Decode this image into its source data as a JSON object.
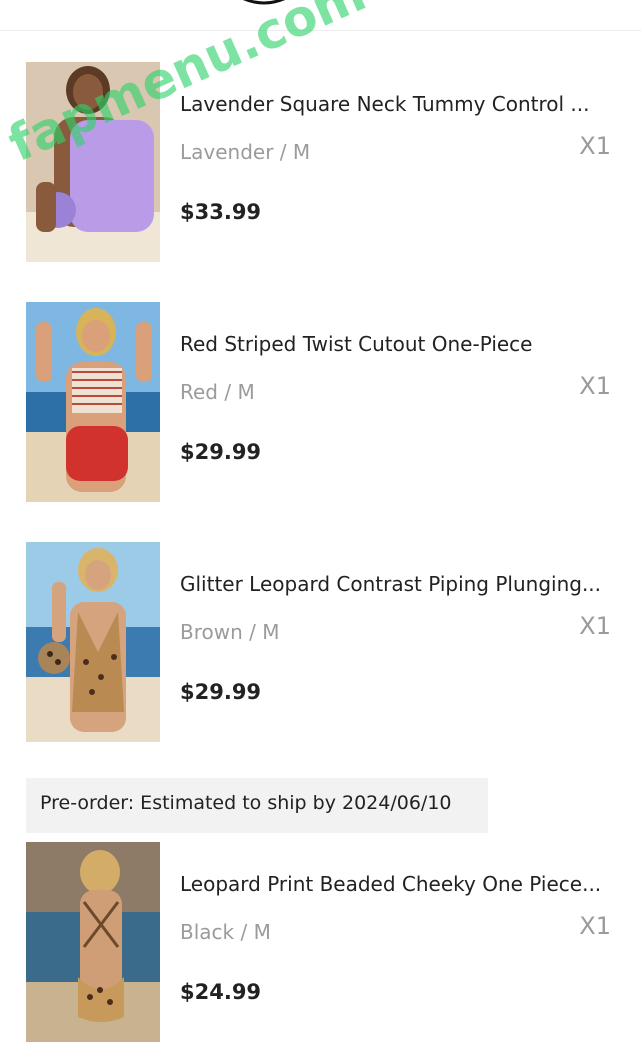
{
  "items": [
    {
      "title": "Lavender Square Neck Tummy Control ...",
      "variant": "Lavender / M",
      "qty": "X1",
      "price": "$33.99",
      "image": "lavender-swimsuit-photo"
    },
    {
      "title": "Red Striped Twist Cutout One-Piece",
      "variant": "Red / M",
      "qty": "X1",
      "price": "$29.99",
      "image": "red-striped-swimsuit-photo"
    },
    {
      "title": "Glitter Leopard Contrast Piping Plunging...",
      "variant": "Brown / M",
      "qty": "X1",
      "price": "$29.99",
      "image": "leopard-swimsuit-photo"
    },
    {
      "title": "Leopard Print Beaded Cheeky One Piece...",
      "variant": "Black / M",
      "qty": "X1",
      "price": "$24.99",
      "image": "leopard-cheeky-swimsuit-photo"
    }
  ],
  "preorder": {
    "text": "Pre-order: Estimated to ship by 2024/06/10"
  },
  "watermark": {
    "text": "fapmenu.com"
  },
  "colors": {
    "accent": "#2fd36a",
    "muted": "#9b9b9b",
    "text": "#222222"
  }
}
